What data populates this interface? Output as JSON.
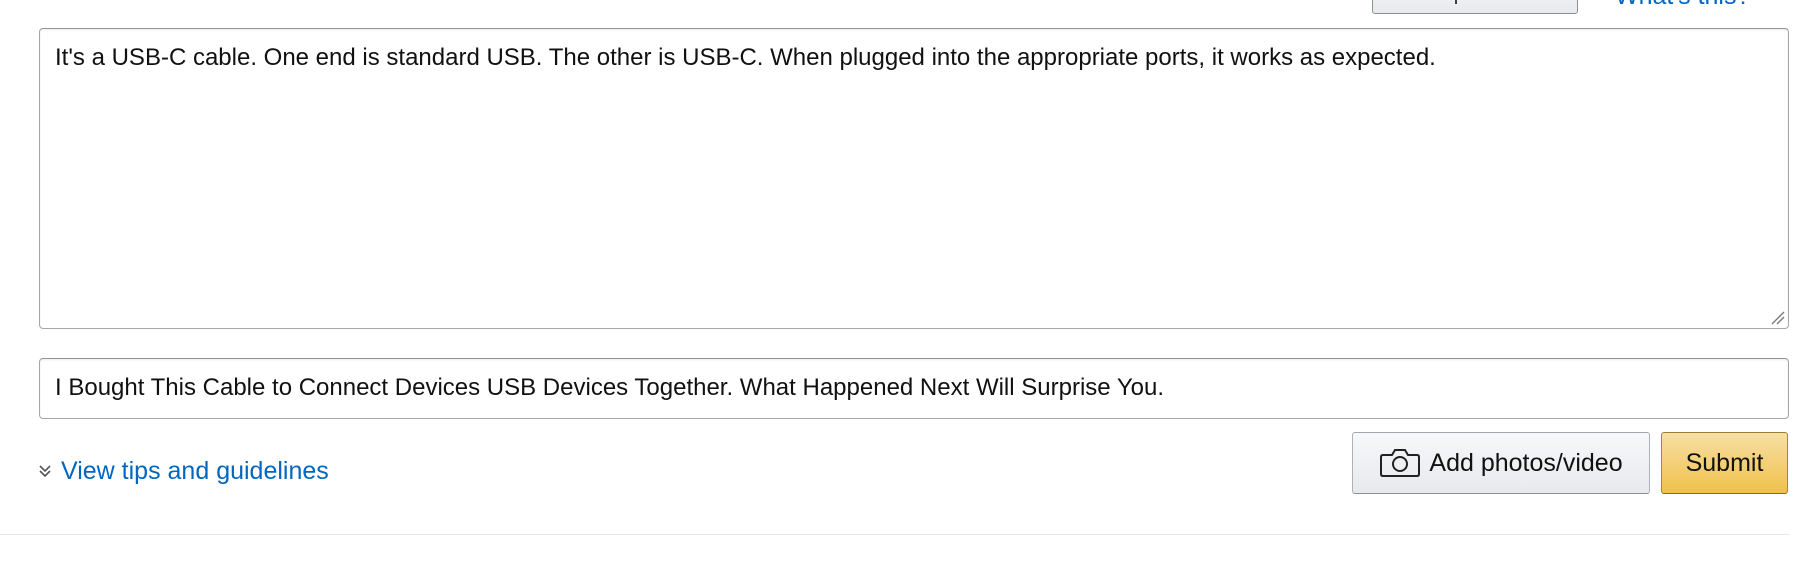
{
  "toolbar": {
    "insert_product_link_label": "Insert product link",
    "whats_this_label": "What's this?"
  },
  "review": {
    "body_text": "It's a USB-C cable. One end is standard USB. The other is USB-C. When plugged into the appropriate ports, it works as expected.",
    "headline_text": "I Bought This Cable to Connect Devices USB Devices Together. What Happened Next Will Surprise You."
  },
  "footer": {
    "tips_link_label": "View tips and guidelines",
    "tips_icon": "double-chevron-down-icon",
    "add_photos_label": "Add photos/video",
    "add_photos_icon": "camera-icon",
    "submit_label": "Submit"
  },
  "colors": {
    "link": "#0066c0",
    "submit_gradient_top": "#f7dfa5",
    "submit_gradient_bottom": "#f0c14b",
    "submit_border": "#a88734",
    "input_border": "#a6a6a6",
    "divider": "#e7e7e7"
  }
}
